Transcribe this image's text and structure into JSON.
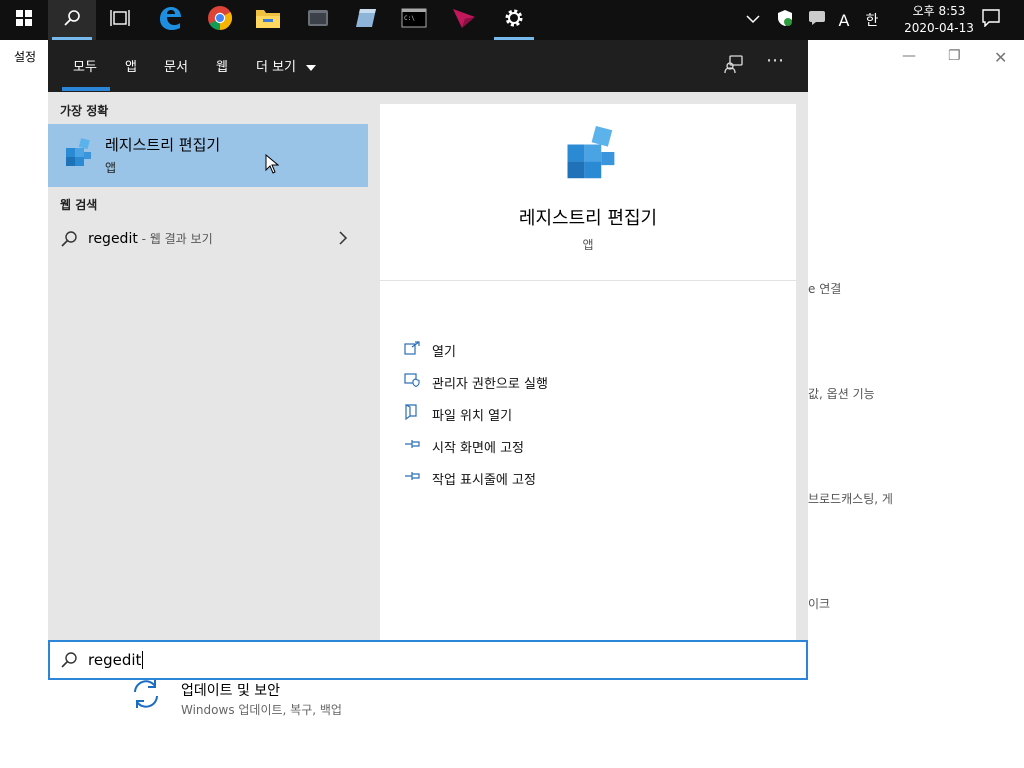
{
  "taskbar": {
    "clock": {
      "time": "오후 8:53",
      "date": "2020-04-13"
    },
    "tray": {
      "ime_mode": "A",
      "ime_lang": "한"
    }
  },
  "settings_bg": {
    "title": "설정",
    "partial_texts": [
      "e 연결",
      "값, 옵션 기능",
      "브로드캐스팅, 게",
      "이크"
    ],
    "update_item": {
      "title": "업데이트 및 보안",
      "subtitle": "Windows 업데이트, 복구, 백업"
    }
  },
  "search_panel": {
    "tabs": [
      "모두",
      "앱",
      "문서",
      "웹",
      "더 보기"
    ],
    "best_match_header": "가장 정확",
    "best_match": {
      "name": "레지스트리 편집기",
      "type": "앱"
    },
    "web_header": "웹 검색",
    "web_result": {
      "query": "regedit",
      "suffix": " - 웹 결과 보기"
    },
    "preview": {
      "name": "레지스트리 편집기",
      "type": "앱"
    },
    "actions": [
      "열기",
      "관리자 권한으로 실행",
      "파일 위치 열기",
      "시작 화면에 고정",
      "작업 표시줄에 고정"
    ],
    "search_value": "regedit"
  },
  "colors": {
    "accent": "#2b86d8",
    "highlight": "#99c4e8",
    "taskbar": "#101010",
    "panel_header": "#1f1f1f"
  }
}
